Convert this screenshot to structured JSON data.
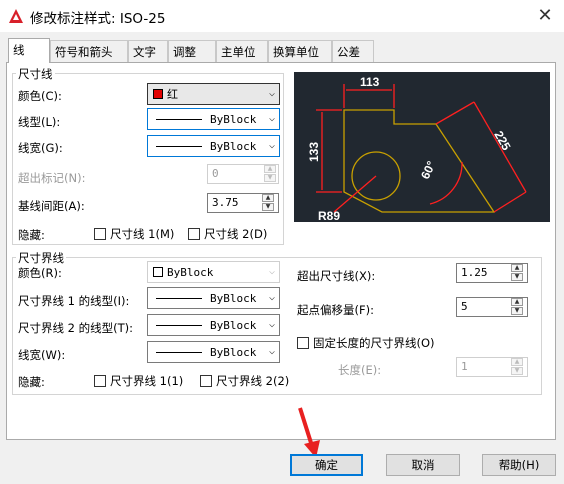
{
  "window": {
    "title": "修改标注样式: ISO-25",
    "close": "✕"
  },
  "tabs": [
    "线",
    "符号和箭头",
    "文字",
    "调整",
    "主单位",
    "换算单位",
    "公差"
  ],
  "dim_lines": {
    "group": "尺寸线",
    "color_label": "颜色(C):",
    "color_value": "红",
    "color_swatch": "#e00000",
    "linetype_label": "线型(L):",
    "linetype_value": "ByBlock",
    "lineweight_label": "线宽(G):",
    "lineweight_value": "ByBlock",
    "extend_label": "超出标记(N):",
    "extend_value": "0",
    "baseline_label": "基线间距(A):",
    "baseline_value": "3.75",
    "suppress_label": "隐藏:",
    "suppress_1": "尺寸线 1(M)",
    "suppress_2": "尺寸线 2(D)"
  },
  "ext_lines": {
    "group": "尺寸界线",
    "color_label": "颜色(R):",
    "color_value": "ByBlock",
    "linetype1_label": "尺寸界线 1 的线型(I):",
    "linetype1_value": "ByBlock",
    "linetype2_label": "尺寸界线 2 的线型(T):",
    "linetype2_value": "ByBlock",
    "lineweight_label": "线宽(W):",
    "lineweight_value": "ByBlock",
    "suppress_label": "隐藏:",
    "suppress_1": "尺寸界线 1(1)",
    "suppress_2": "尺寸界线 2(2)",
    "extend_beyond_label": "超出尺寸线(X):",
    "extend_beyond_value": "1.25",
    "offset_label": "起点偏移量(F):",
    "offset_value": "5",
    "fixed_label": "固定长度的尺寸界线(O)",
    "length_label": "长度(E):",
    "length_value": "1"
  },
  "preview": {
    "dim_top": "113",
    "dim_left": "133",
    "dim_right": "225",
    "angle": "60°",
    "radius": "R89",
    "accent": "#ff2020",
    "geom": "#c8a000"
  },
  "buttons": {
    "ok": "确定",
    "cancel": "取消",
    "help": "帮助(H)"
  }
}
